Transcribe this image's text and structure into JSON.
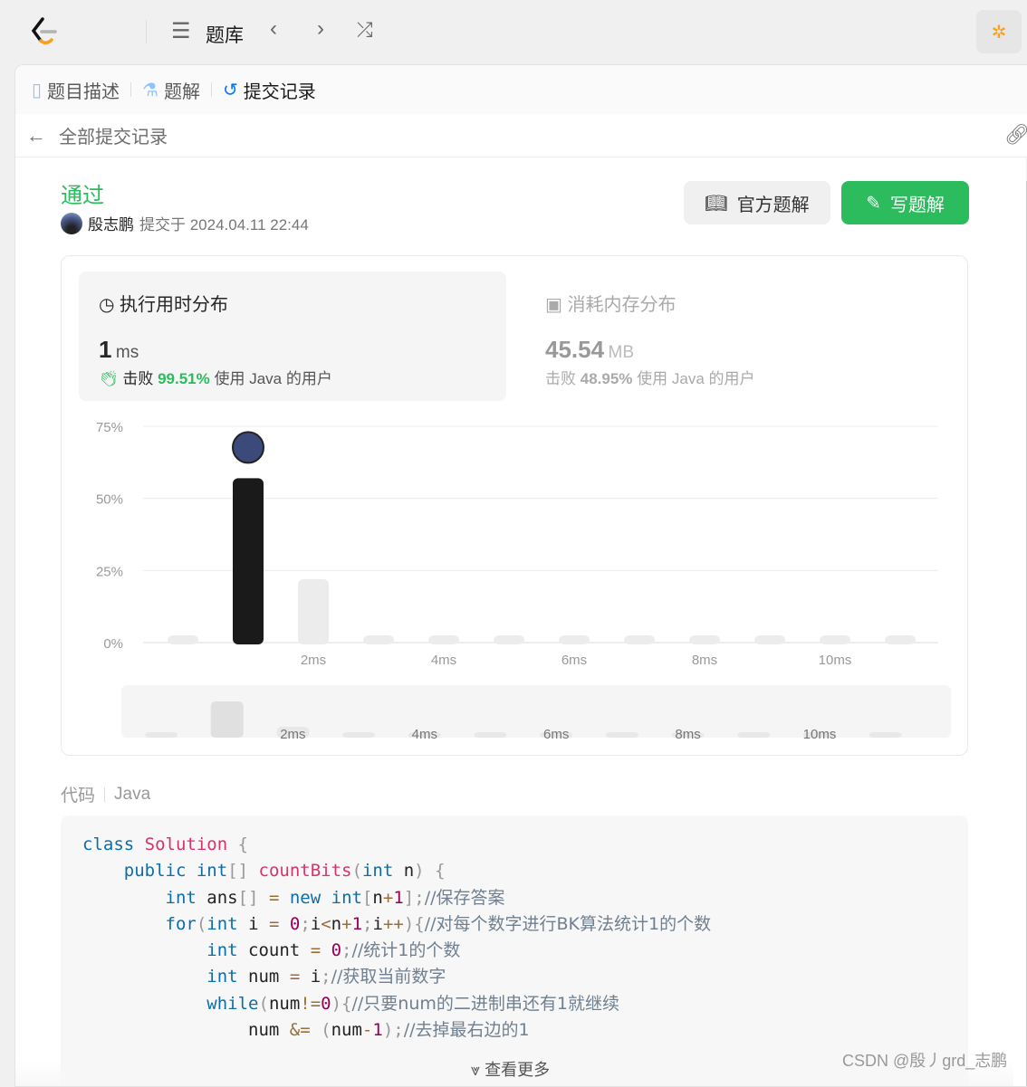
{
  "topbar": {
    "problem_list": "题库",
    "logo_icon": "leetcode-logo",
    "debug_icon": "bug-lock-icon"
  },
  "tabs": [
    {
      "label": "题目描述",
      "icon": "document-icon"
    },
    {
      "label": "题解",
      "icon": "flask-icon"
    },
    {
      "label": "提交记录",
      "icon": "history-icon"
    }
  ],
  "sub": {
    "back_label": "全部提交记录"
  },
  "submission": {
    "status": "通过",
    "user": "殷志鹏",
    "submitted_at": "提交于 2024.04.11 22:44",
    "status_color": "#2cbb5d"
  },
  "buttons": {
    "official": "官方题解",
    "write": "写题解"
  },
  "runtime": {
    "title": "执行用时分布",
    "value": "1",
    "unit": "ms",
    "beat_label": "击败",
    "beat": "99.51%",
    "suffix": "使用 Java 的用户"
  },
  "memory": {
    "title": "消耗内存分布",
    "value": "45.54",
    "unit": "MB",
    "beat_label": "击败",
    "beat": "48.95%",
    "suffix": "使用 Java 的用户"
  },
  "chart_data": {
    "type": "bar",
    "x": [
      0,
      1,
      2,
      3,
      4,
      5,
      6,
      7,
      8,
      9,
      10,
      11
    ],
    "values": [
      0,
      57,
      22,
      0,
      0,
      0,
      0,
      0,
      0,
      0,
      0,
      0
    ],
    "highlight_x": 1,
    "yticks": [
      "0%",
      "25%",
      "50%",
      "75%"
    ],
    "ylim": [
      0,
      75
    ],
    "xticks": [
      {
        "x": 2,
        "label": "2ms"
      },
      {
        "x": 4,
        "label": "4ms"
      },
      {
        "x": 6,
        "label": "6ms"
      },
      {
        "x": 8,
        "label": "8ms"
      },
      {
        "x": 10,
        "label": "10ms"
      }
    ],
    "grid": true
  },
  "code": {
    "label": "代码",
    "lang": "Java",
    "more": "查看更多"
  },
  "watermark": "CSDN @殷丿grd_志鹏"
}
